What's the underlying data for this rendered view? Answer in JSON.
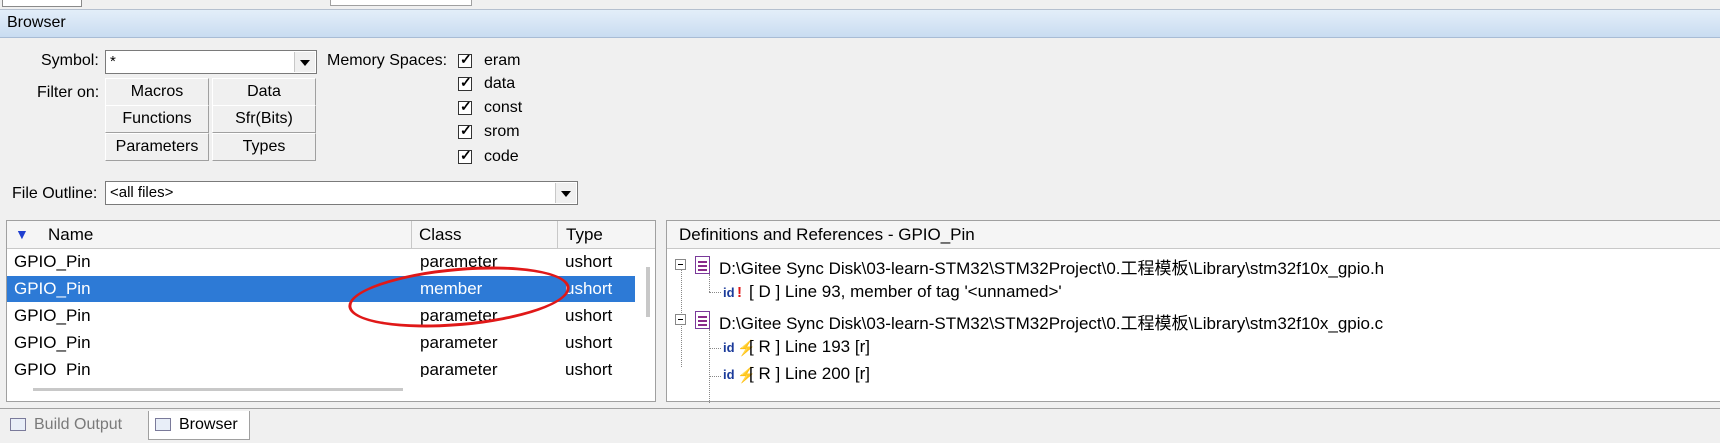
{
  "window": {
    "title": "Browser"
  },
  "filters": {
    "symbol_label": "Symbol:",
    "symbol_value": "*",
    "filter_on_label": "Filter on:",
    "buttons": [
      "Macros",
      "Data",
      "Functions",
      "Sfr(Bits)",
      "Parameters",
      "Types"
    ],
    "memory_spaces_label": "Memory Spaces:",
    "memory_spaces": [
      {
        "label": "eram",
        "checked": true
      },
      {
        "label": "data",
        "checked": true
      },
      {
        "label": "const",
        "checked": true
      },
      {
        "label": "srom",
        "checked": true
      },
      {
        "label": "code",
        "checked": true
      }
    ],
    "file_outline_label": "File Outline:",
    "file_outline_value": "<all files>"
  },
  "symbols": {
    "columns": [
      "Name",
      "Class",
      "Type"
    ],
    "rows": [
      {
        "name": "GPIO_Pin",
        "class": "parameter",
        "type": "ushort",
        "selected": false
      },
      {
        "name": "GPIO_Pin",
        "class": "member",
        "type": "ushort",
        "selected": true
      },
      {
        "name": "GPIO_Pin",
        "class": "parameter",
        "type": "ushort",
        "selected": false
      },
      {
        "name": "GPIO_Pin",
        "class": "parameter",
        "type": "ushort",
        "selected": false
      },
      {
        "name": "GPIO_Pin",
        "class": "parameter",
        "type": "ushort",
        "selected": false
      }
    ]
  },
  "definitions": {
    "header": "Definitions and References - GPIO_Pin",
    "files": [
      {
        "path": "D:\\Gitee Sync Disk\\03-learn-STM32\\STM32Project\\0.工程模板\\Library\\stm32f10x_gpio.h",
        "refs": [
          {
            "text": "[ D ] Line 93, member of tag '<unnamed>'",
            "kind": "definition"
          }
        ]
      },
      {
        "path": "D:\\Gitee Sync Disk\\03-learn-STM32\\STM32Project\\0.工程模板\\Library\\stm32f10x_gpio.c",
        "refs": [
          {
            "text": "[ R ] Line 193 [r]",
            "kind": "reference"
          },
          {
            "text": "[ R ] Line 200 [r]",
            "kind": "reference"
          }
        ]
      }
    ]
  },
  "bottom_tabs": [
    {
      "label": "Build Output",
      "active": false
    },
    {
      "label": "Browser",
      "active": true
    }
  ],
  "colors": {
    "selection": "#2d7ad6",
    "annotation": "#e01818",
    "sort_arrow": "#1f3fd0"
  }
}
